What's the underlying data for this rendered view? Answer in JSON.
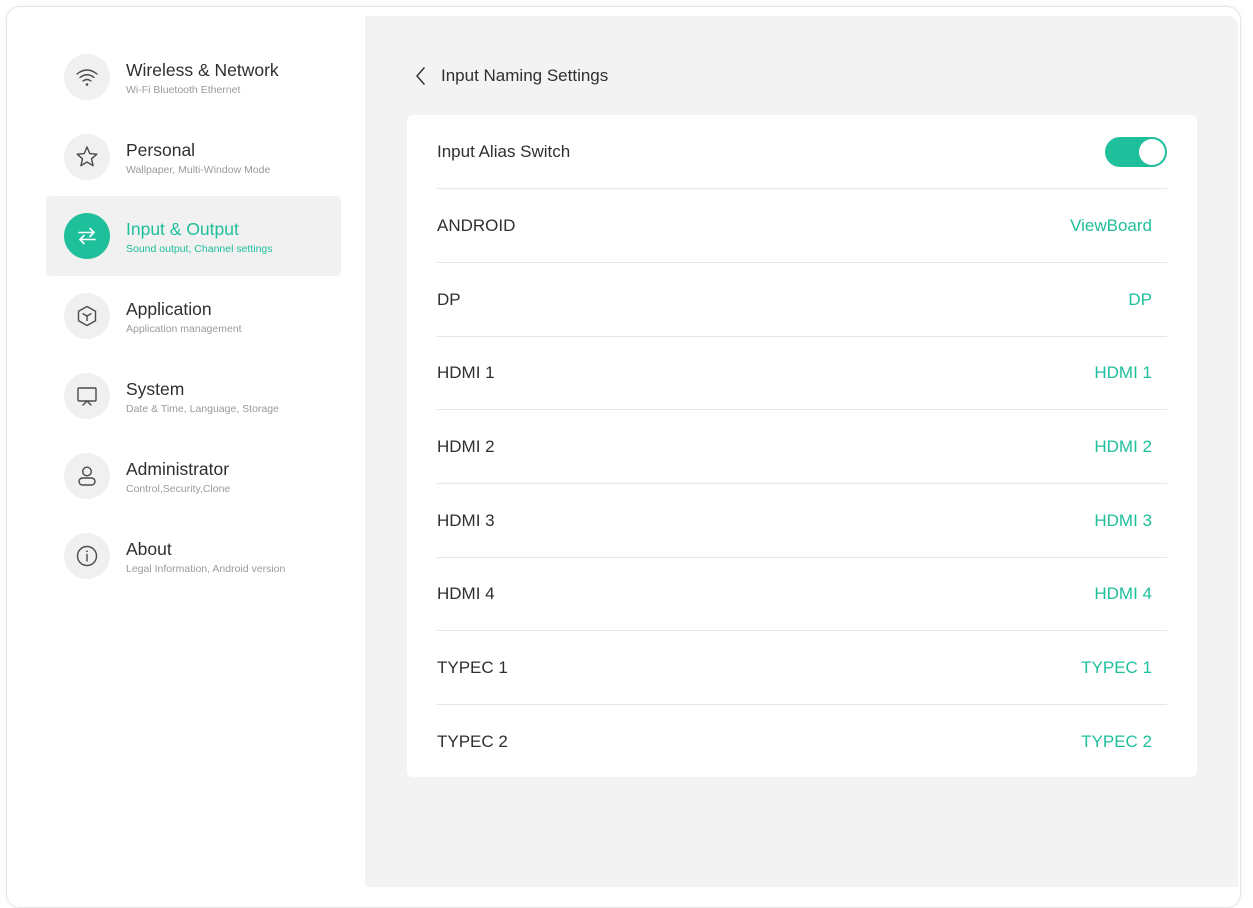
{
  "sidebar": {
    "items": [
      {
        "title": "Wireless & Network",
        "subtitle": "Wi-Fi Bluetooth Ethernet",
        "icon": "wifi-icon"
      },
      {
        "title": "Personal",
        "subtitle": "Wallpaper, Multi-Window Mode",
        "icon": "star-icon"
      },
      {
        "title": "Input & Output",
        "subtitle": "Sound output, Channel settings",
        "icon": "swap-arrows-icon",
        "active": true
      },
      {
        "title": "Application",
        "subtitle": "Application management",
        "icon": "cube-icon"
      },
      {
        "title": "System",
        "subtitle": "Date & Time, Language, Storage",
        "icon": "monitor-icon"
      },
      {
        "title": "Administrator",
        "subtitle": "Control,Security,Clone",
        "icon": "user-icon"
      },
      {
        "title": "About",
        "subtitle": "Legal Information, Android version",
        "icon": "info-icon"
      }
    ]
  },
  "header": {
    "title": "Input Naming Settings"
  },
  "settings": {
    "alias_switch": {
      "label": "Input Alias Switch",
      "enabled": true
    },
    "rows": [
      {
        "label": "ANDROID",
        "value": "ViewBoard"
      },
      {
        "label": "DP",
        "value": "DP"
      },
      {
        "label": "HDMI 1",
        "value": "HDMI 1"
      },
      {
        "label": "HDMI 2",
        "value": "HDMI 2"
      },
      {
        "label": "HDMI 3",
        "value": "HDMI 3"
      },
      {
        "label": "HDMI 4",
        "value": "HDMI 4"
      },
      {
        "label": "TYPEC 1",
        "value": "TYPEC 1"
      },
      {
        "label": "TYPEC 2",
        "value": "TYPEC 2"
      }
    ]
  },
  "colors": {
    "accent": "#1ebf9b",
    "background": "#f3f3f3",
    "text": "#2f2f2f",
    "muted": "#9a9a9a"
  }
}
